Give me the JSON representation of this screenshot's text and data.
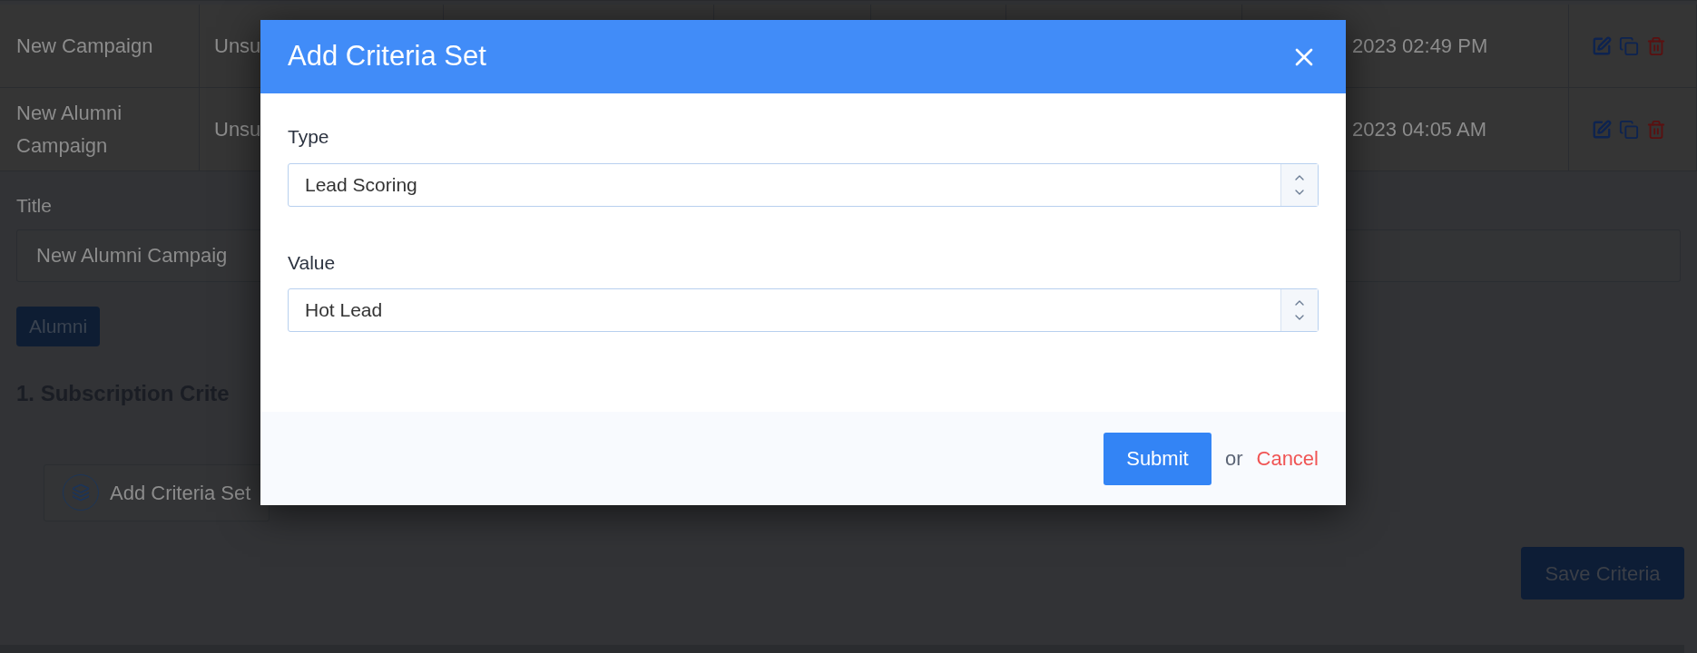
{
  "table": {
    "rows": [
      {
        "name": "New Campaign",
        "column_2": "Unsu",
        "date": "2023 02:49 PM"
      },
      {
        "name": "New Alumni Campaign",
        "column_2": "Unsu",
        "date": "2023 04:05 AM"
      }
    ]
  },
  "title_field": {
    "label": "Title",
    "value": "New Alumni Campaig"
  },
  "tags": [
    "Alumni"
  ],
  "section_heading": "1. Subscription Crite",
  "add_criteria_set_button": "Add Criteria Set",
  "save_button": "Save Criteria",
  "dialog": {
    "title": "Add Criteria Set",
    "fields": [
      {
        "label": "Type",
        "value": "Lead Scoring"
      },
      {
        "label": "Value",
        "value": "Hot Lead"
      }
    ],
    "submit": "Submit",
    "or": "or",
    "cancel": "Cancel"
  }
}
